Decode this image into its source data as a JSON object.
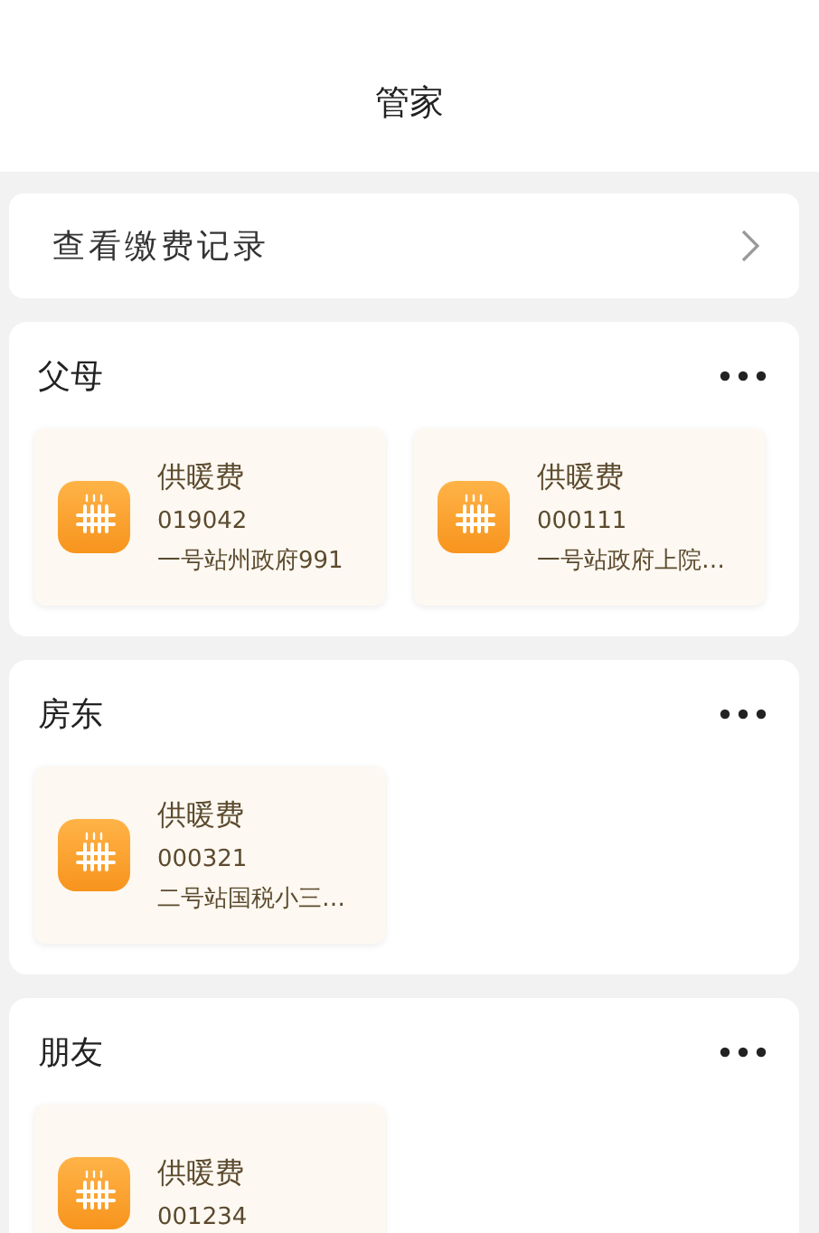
{
  "header": {
    "title": "管家"
  },
  "record_link": {
    "label": "查看缴费记录"
  },
  "groups": [
    {
      "name": "父母",
      "items": [
        {
          "category": "供暖费",
          "account": "019042",
          "address": "一号站州政府991"
        },
        {
          "category": "供暖费",
          "account": "000111",
          "address": "一号站政府上院…"
        }
      ]
    },
    {
      "name": "房东",
      "items": [
        {
          "category": "供暖费",
          "account": "000321",
          "address": "二号站国税小三…"
        }
      ]
    },
    {
      "name": "朋友",
      "items": [
        {
          "category": "供暖费",
          "account": "001234"
        }
      ]
    }
  ]
}
